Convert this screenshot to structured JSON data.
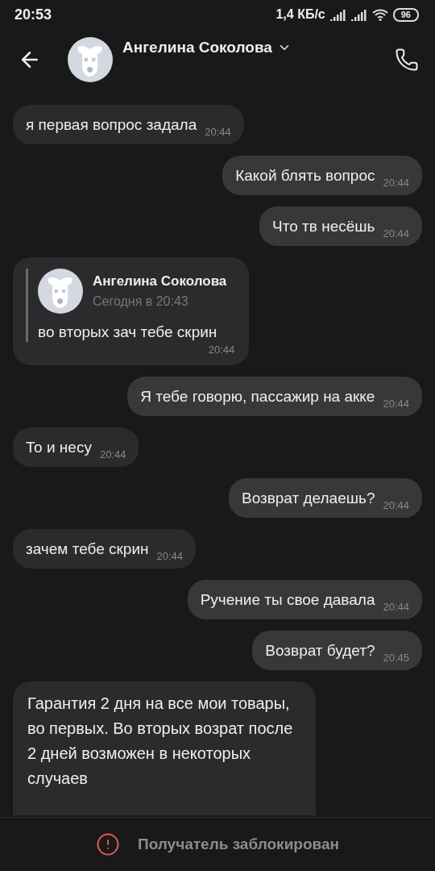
{
  "status_bar": {
    "time": "20:53",
    "speed": "1,4 КБ/с",
    "battery": "96"
  },
  "header": {
    "name": "Ангелина Соколова"
  },
  "messages": [
    {
      "kind": "text",
      "outgoing": false,
      "text": "я первая вопрос задала",
      "time": "20:44"
    },
    {
      "kind": "text",
      "outgoing": true,
      "text": "Какой блять вопрос",
      "time": "20:44"
    },
    {
      "kind": "text",
      "outgoing": true,
      "text": "Что тв несёшь",
      "time": "20:44"
    },
    {
      "kind": "reply",
      "outgoing": false,
      "author": "Ангелина Соколова",
      "date": "Сегодня в 20:43",
      "text": "во вторых зач тебе скрин",
      "time": "20:44"
    },
    {
      "kind": "text",
      "outgoing": true,
      "text": "Я тебе говорю, пассажир на акке",
      "time": "20:44"
    },
    {
      "kind": "text",
      "outgoing": false,
      "text": "То и несу",
      "time": "20:44"
    },
    {
      "kind": "text",
      "outgoing": true,
      "text": "Возврат делаешь?",
      "time": "20:44"
    },
    {
      "kind": "text",
      "outgoing": false,
      "text": "зачем тебе скрин",
      "time": "20:44"
    },
    {
      "kind": "text",
      "outgoing": true,
      "text": "Ручение ты свое давала",
      "time": "20:44"
    },
    {
      "kind": "text",
      "outgoing": true,
      "text": "Возврат будет?",
      "time": "20:45"
    },
    {
      "kind": "long",
      "outgoing": false,
      "text": "Гарантия 2 дня на все мои товары, во первых. Во вторых возрат после 2 дней возможен в некоторых случаев"
    }
  ],
  "footer": {
    "notice": "Получатель заблокирован"
  }
}
